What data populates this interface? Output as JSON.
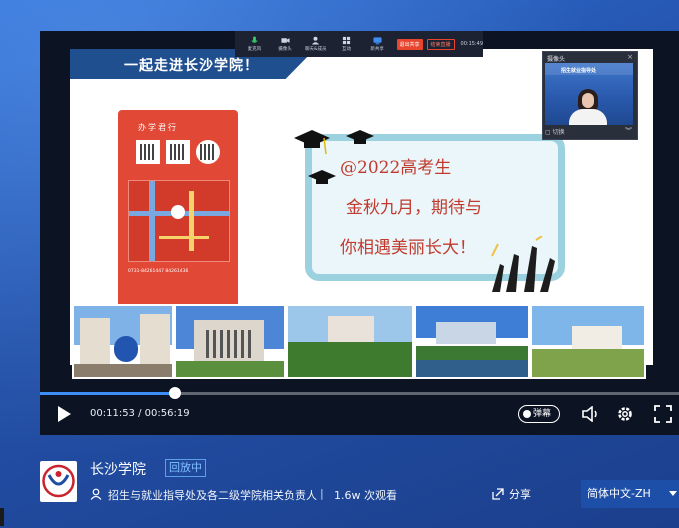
{
  "slide": {
    "title": "一起走进长沙学院！",
    "poster_heading": "办学君行",
    "poster_phone": "0731-84261447  84261436",
    "board_lines": [
      "@2022高考生",
      "金秋九月，期待与",
      "你相遇美丽长大！"
    ]
  },
  "toolbar": {
    "items": [
      "麦克风",
      "摄像头",
      "聊天&成员",
      "互动",
      "新共享"
    ],
    "stop_share": "退出共享",
    "end_live": "结束直播",
    "time": "00:15:49"
  },
  "camera": {
    "title": "摄像头",
    "banner": "招生就业指导处",
    "footer": "切换"
  },
  "player": {
    "time": "00:11:53 / 00:56:19",
    "progress": 0.211,
    "danmu_label": "弹幕"
  },
  "info": {
    "channel": "长沙学院",
    "status": "回放中",
    "host": "招生与就业指导处及各二级学院相关负责人",
    "separator": "|",
    "views": "1.6w 次观看",
    "share": "分享",
    "language": "简体中文-ZH"
  }
}
